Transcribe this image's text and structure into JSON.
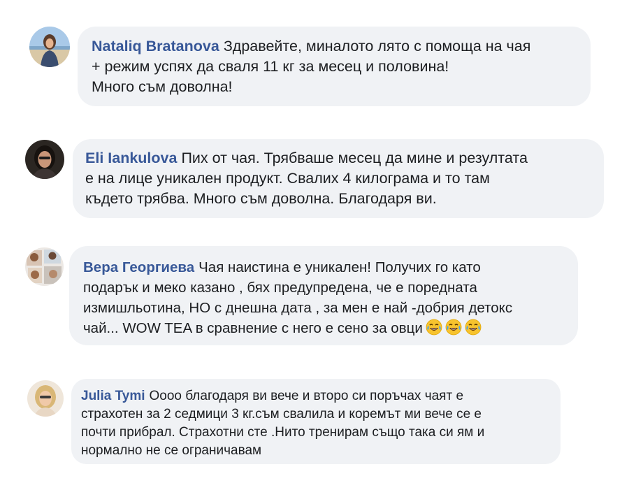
{
  "comments": [
    {
      "author": "Nataliq Bratanova",
      "lines": [
        "Здравейте, миналото лято с помоща на чая",
        "+ режим успях да сваля 11 кг за месец и половина!",
        "Много съм доволна!"
      ]
    },
    {
      "author": "Eli Iankulova",
      "lines": [
        "Пих от чая. Трябваше месец да мине и резултата",
        "е на лице уникален продукт. Свалих 4 килограма и то там",
        "където трябва. Много съм доволна. Благодаря ви."
      ]
    },
    {
      "author": "Вера Георгиева",
      "lines": [
        "Чая наистина е уникален! Получих го като",
        "подарък и меко казано , бях предупредена, че е поредната",
        "измишльотина, НО с днешна дата , за мен е най -добрия детокс",
        "чай... WOW TEA в сравнение с него е сено за овци"
      ],
      "emoji": "laughing-tears-icon"
    },
    {
      "author": "Julia Tymi",
      "lines": [
        "Оооо благодаря ви вече и второ си поръчах чаят е",
        "страхотен за 2 седмици 3 кг.съм свалила и коремът ми вече се е",
        "почти прибрал. Страхотни сте .Нито тренирам също така си ям и",
        "нормално не се ограничавам"
      ]
    }
  ]
}
